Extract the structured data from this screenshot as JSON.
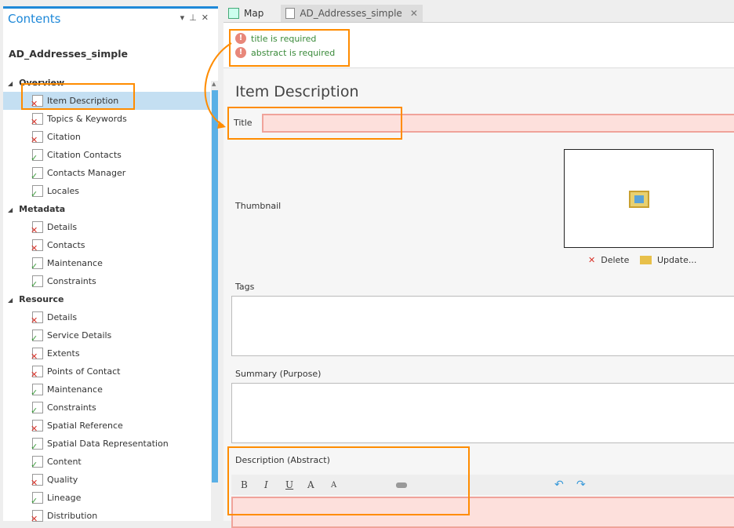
{
  "contents_pane": {
    "title": "Contents",
    "item_name": "AD_Addresses_simple",
    "sections": [
      {
        "label": "Overview",
        "items": [
          {
            "label": "Item Description",
            "status": "error",
            "selected": true
          },
          {
            "label": "Topics & Keywords",
            "status": "error"
          },
          {
            "label": "Citation",
            "status": "error"
          },
          {
            "label": "Citation Contacts",
            "status": "ok"
          },
          {
            "label": "Contacts Manager",
            "status": "ok"
          },
          {
            "label": "Locales",
            "status": "ok"
          }
        ]
      },
      {
        "label": "Metadata",
        "items": [
          {
            "label": "Details",
            "status": "error"
          },
          {
            "label": "Contacts",
            "status": "error"
          },
          {
            "label": "Maintenance",
            "status": "ok"
          },
          {
            "label": "Constraints",
            "status": "ok"
          }
        ]
      },
      {
        "label": "Resource",
        "items": [
          {
            "label": "Details",
            "status": "error"
          },
          {
            "label": "Service Details",
            "status": "ok"
          },
          {
            "label": "Extents",
            "status": "error"
          },
          {
            "label": "Points of Contact",
            "status": "error"
          },
          {
            "label": "Maintenance",
            "status": "ok"
          },
          {
            "label": "Constraints",
            "status": "ok"
          },
          {
            "label": "Spatial Reference",
            "status": "error"
          },
          {
            "label": "Spatial Data Representation",
            "status": "ok"
          },
          {
            "label": "Content",
            "status": "ok"
          },
          {
            "label": "Quality",
            "status": "error"
          },
          {
            "label": "Lineage",
            "status": "ok"
          },
          {
            "label": "Distribution",
            "status": "error"
          }
        ]
      }
    ]
  },
  "tabs": [
    {
      "label": "Map"
    },
    {
      "label": "AD_Addresses_simple",
      "active": true
    }
  ],
  "messages": [
    "title is required",
    "abstract is required"
  ],
  "editor": {
    "heading": "Item Description",
    "title_label": "Title",
    "title_value": "",
    "thumbnail_label": "Thumbnail",
    "delete_label": "Delete",
    "update_label": "Update...",
    "tags_label": "Tags",
    "summary_label": "Summary (Purpose)",
    "description_label": "Description (Abstract)",
    "toolbar": {
      "bold": "B",
      "italic": "I",
      "underline": "U",
      "grow": "A",
      "shrink": "A"
    }
  },
  "colors": {
    "accent": "#1e88d8",
    "highlight": "#ff8c00",
    "error_fill": "#fde0dc",
    "message_text": "#3a8a3a"
  }
}
